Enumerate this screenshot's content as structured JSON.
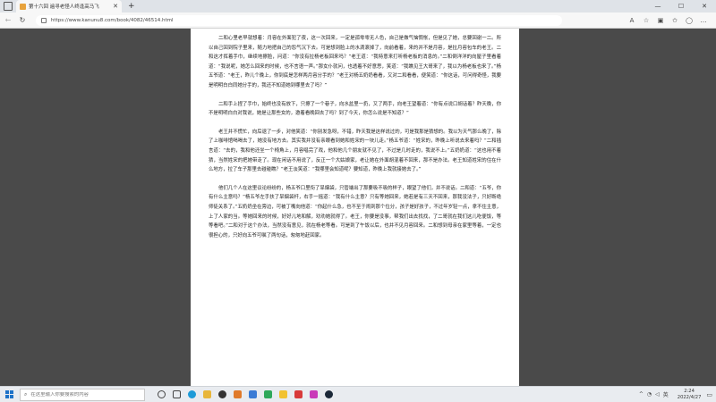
{
  "browser": {
    "tab_title": "第十六回 遍寻老怪人终逢高马飞",
    "url": "https://www.kanunu8.com/book/4082/46514.html",
    "window_controls": [
      "—",
      "☐",
      "✕"
    ]
  },
  "content": {
    "paragraphs": [
      "二和心里老早就想着：月容在外面犯了夜，这一次回来，一定是孤零零无人色，自己是做气恼惆怅，但是见了她，总要回谢一二。所以自己回到院子里来，随力地把自己的怨气沉下去。可是想到脸上的水滴滚掉了，向前看着，来的并不是月容，是拉月容包车的老王。二和这才挥着手巾，继续地擦脸，问道：“你没有拉杨老板回来吗？”老王道：“我特意来打听杨老板的消息的。”二和倒洋洋的向屋子里看着道：“我说呢，她怎么回来的时候，也不言语一声。”那女仆就问，也透着不好意思，笑道：“我瞧见王大哥来了，我以为杨老板也来了。”杨五爷道：“老王，昨儿个晚上，你到底是怎样两月容分手的？”老王对杨五奶奶看看，又对二和看看，便笑道：“你这话，可问得奇怪，我要是明明白白同她分手的，我还不知道她到哪里去了吗？”",
      "二和手上捏了手巾，始终也没有放下，只擦了一个巷子，向水盆里一扔，又了两手，向老王望着道：“你有点说口胡话着？昨天晚，你不是明明白白对我说，她是让那些女的，邀着看晚回去了吗？到了今天，你怎么说是不知道？”",
      "老王并不慌忙，向后退了一步，对他笑道：“你别发急呀，不错，昨天我是这样说过的，可是我那是猜想的。我以为天气那么晚了，除了上咖啡馆喝喝去了，她没有地方去。其实我并没有亲眼看到她和姓宋的一块儿走。”杨五爷道：“姓宋的，昨晚上听说去来着吗？”二和插言道：“去的，我和他还坐一个椅角上，月容唱完了戏，他和他几个朋友就不见了，不过是几时走的，我说不上。”五奶奶道：“这也用不着猜，当然姓宋的把她带走了。现在闲话不用说了，反正一个大姑娘家，老让她在外面胡混着不回来，那不是办法。老王知道姓宋的住在什么地方，拉了车子那里去碰碰瞧？”老王淡笑道：“我哪里会知道呢？要知道，昨晚上我就接她去了。”",
      "他们几个人在这里议论纷纷的，杨五爷口里衔了旱烟袋，只管端出了那要吸不吸的样子，眼望了他们，并不说话。二和道：“五爷，你有什么主意吗？”杨五爷左手扶了旱烟袋杆，右手一摇道：“我有什么主意？只有等她回来，她若是有三天不回来，那我没法子，只好断绝师徒关系了。”五奶奶坐在旁边，可被丁嘴向他道：“你起什么急，也不至于闹到那个位分，孩子是好孩子，不过年岁轻一点，拿不住主意，上了人家的当。等她回来的时候，好好儿地和解，劝劝她就得了。老王，你要是没事，帮我们出去找找，了二哥就在我们这儿吃便饭，等等看吧。”二和对于这个办法，当然没有意见，就在杨老等看。可是到了午饭以后，也并不见月容回来。二和想到母亲在家里等着，一定也很担心的，只好向五爷可嘱了两句话，匆匆地赶回家。"
    ]
  },
  "taskbar": {
    "search_placeholder": "在这里输入你要搜索的内容",
    "time": "2:24",
    "date": "2022/4/27",
    "tray_lang": "英"
  },
  "colors": {
    "page_bg": "#4a4a4a",
    "paper_bg": "#ffffff",
    "windows_blue": "#1e73c8"
  }
}
